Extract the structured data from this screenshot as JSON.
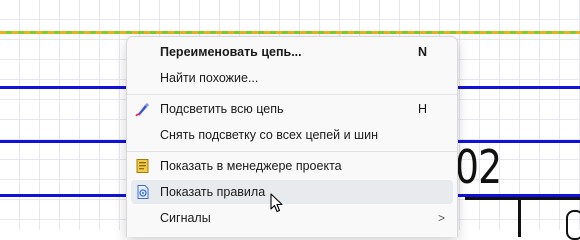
{
  "menu": {
    "rename_net": "Переименовать цепь...",
    "rename_shortcut": "N",
    "find_similar": "Найти похожие...",
    "highlight_net": "Подсветить всю цепь",
    "highlight_shortcut": "H",
    "clear_highlight": "Снять подсветку со всех цепей и шин",
    "show_in_manager": "Показать в менеджере проекта",
    "show_rules": "Показать правила",
    "signals": "Сигналы",
    "signals_chevron": ">"
  },
  "canvas": {
    "reference_text": "02"
  },
  "icons": {
    "highlight": "highlight-brush-icon",
    "project_manager": "project-manager-icon",
    "rules": "rules-document-icon"
  },
  "colors": {
    "wire": "#1111dd",
    "highlighted_net": "#f0b21c",
    "menu_hover": "#e8ebee"
  }
}
